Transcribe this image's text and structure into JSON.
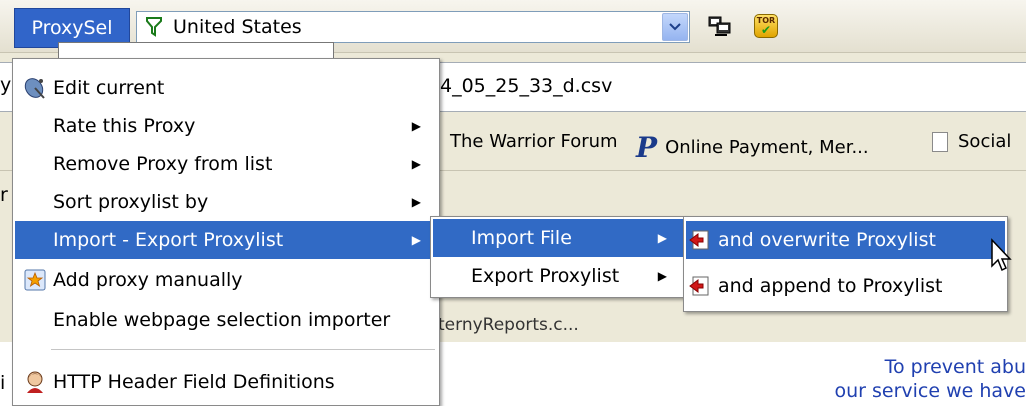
{
  "toolbar": {
    "proxysel_label": "ProxySel",
    "country_value": "United States",
    "tor_label": "TOR"
  },
  "address_bar": {
    "text": "4_05_25_33_d.csv"
  },
  "bookmarks": [
    {
      "label": "The Warrior Forum"
    },
    {
      "label": "Online Payment, Mer..."
    },
    {
      "label": "Social"
    }
  ],
  "background_tab": {
    "label": "ternyReports.c..."
  },
  "page": {
    "line1": "To prevent abu",
    "line2": "our service we have"
  },
  "left_edge": [
    "y",
    "r",
    "i"
  ],
  "main_menu": {
    "items": [
      {
        "label": "Edit current",
        "icon": "satellite-dish-icon",
        "has_submenu": false
      },
      {
        "label": "Rate this Proxy",
        "has_submenu": true
      },
      {
        "label": "Remove Proxy from list",
        "has_submenu": true
      },
      {
        "label": "Sort proxylist by",
        "has_submenu": true
      },
      {
        "label": "Import - Export Proxylist",
        "has_submenu": true,
        "highlighted": true
      },
      {
        "label": "Add proxy manually",
        "icon": "add-star-icon",
        "has_submenu": false
      },
      {
        "label": "Enable webpage selection importer",
        "has_submenu": false
      },
      {
        "label": "HTTP Header Field Definitions",
        "icon": "person-icon",
        "has_submenu": false
      }
    ]
  },
  "import_export_menu": {
    "items": [
      {
        "label": "Import File",
        "has_submenu": true,
        "highlighted": true
      },
      {
        "label": "Export Proxylist",
        "has_submenu": true
      }
    ]
  },
  "import_file_menu": {
    "items": [
      {
        "label": "and overwrite Proxylist",
        "icon": "import-file-icon",
        "highlighted": true
      },
      {
        "label": "and append to Proxylist",
        "icon": "import-file-icon"
      }
    ]
  },
  "colors": {
    "highlight": "#316ac5",
    "toolbar_button": "#3165c9",
    "page_text": "#2040b0"
  }
}
